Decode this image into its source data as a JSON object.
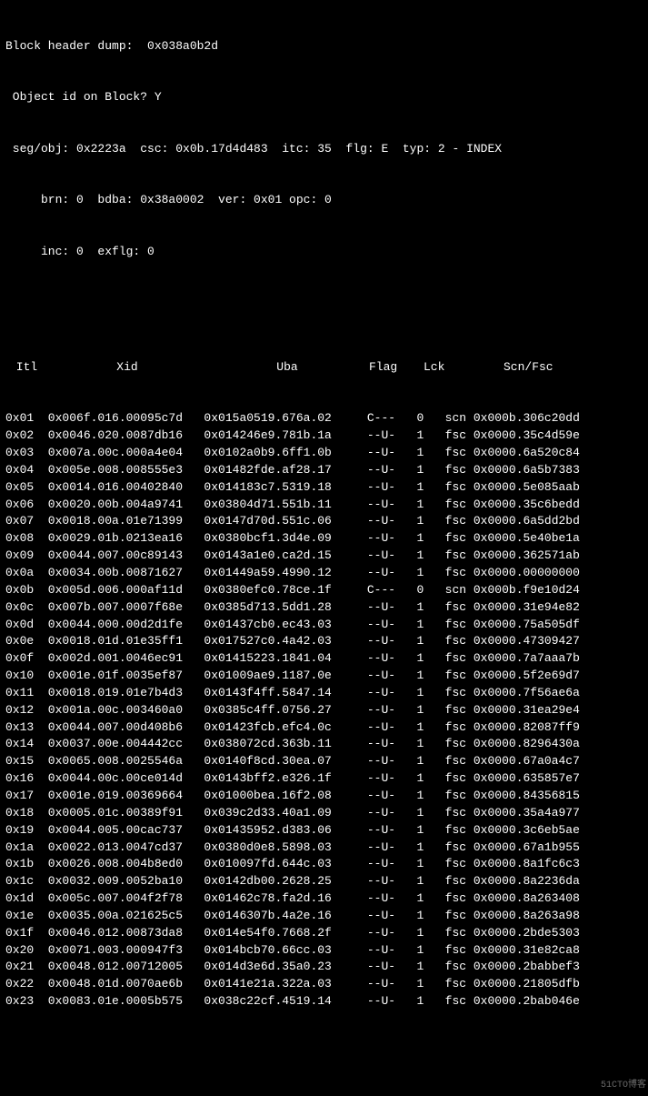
{
  "header": {
    "line1": "Block header dump:  0x038a0b2d",
    "line2": " Object id on Block? Y",
    "line3": " seg/obj: 0x2223a  csc: 0x0b.17d4d483  itc: 35  flg: E  typ: 2 - INDEX",
    "line4": "     brn: 0  bdba: 0x38a0002  ver: 0x01 opc: 0",
    "line5": "     inc: 0  exflg: 0"
  },
  "columns": {
    "itl": " Itl",
    "xid": "Xid",
    "uba": "Uba",
    "flag": "Flag",
    "lck": "Lck",
    "scn": "Scn/Fsc"
  },
  "rows": [
    {
      "itl": "0x01",
      "xid": "0x006f.016.00095c7d",
      "uba": "0x015a0519.676a.02",
      "flag": "C---",
      "lck": "0",
      "scn": "scn 0x000b.306c20dd"
    },
    {
      "itl": "0x02",
      "xid": "0x0046.020.0087db16",
      "uba": "0x014246e9.781b.1a",
      "flag": "--U-",
      "lck": "1",
      "scn": "fsc 0x0000.35c4d59e"
    },
    {
      "itl": "0x03",
      "xid": "0x007a.00c.000a4e04",
      "uba": "0x0102a0b9.6ff1.0b",
      "flag": "--U-",
      "lck": "1",
      "scn": "fsc 0x0000.6a520c84"
    },
    {
      "itl": "0x04",
      "xid": "0x005e.008.008555e3",
      "uba": "0x01482fde.af28.17",
      "flag": "--U-",
      "lck": "1",
      "scn": "fsc 0x0000.6a5b7383"
    },
    {
      "itl": "0x05",
      "xid": "0x0014.016.00402840",
      "uba": "0x014183c7.5319.18",
      "flag": "--U-",
      "lck": "1",
      "scn": "fsc 0x0000.5e085aab"
    },
    {
      "itl": "0x06",
      "xid": "0x0020.00b.004a9741",
      "uba": "0x03804d71.551b.11",
      "flag": "--U-",
      "lck": "1",
      "scn": "fsc 0x0000.35c6bedd"
    },
    {
      "itl": "0x07",
      "xid": "0x0018.00a.01e71399",
      "uba": "0x0147d70d.551c.06",
      "flag": "--U-",
      "lck": "1",
      "scn": "fsc 0x0000.6a5dd2bd"
    },
    {
      "itl": "0x08",
      "xid": "0x0029.01b.0213ea16",
      "uba": "0x0380bcf1.3d4e.09",
      "flag": "--U-",
      "lck": "1",
      "scn": "fsc 0x0000.5e40be1a"
    },
    {
      "itl": "0x09",
      "xid": "0x0044.007.00c89143",
      "uba": "0x0143a1e0.ca2d.15",
      "flag": "--U-",
      "lck": "1",
      "scn": "fsc 0x0000.362571ab"
    },
    {
      "itl": "0x0a",
      "xid": "0x0034.00b.00871627",
      "uba": "0x01449a59.4990.12",
      "flag": "--U-",
      "lck": "1",
      "scn": "fsc 0x0000.00000000"
    },
    {
      "itl": "0x0b",
      "xid": "0x005d.006.000af11d",
      "uba": "0x0380efc0.78ce.1f",
      "flag": "C---",
      "lck": "0",
      "scn": "scn 0x000b.f9e10d24"
    },
    {
      "itl": "0x0c",
      "xid": "0x007b.007.0007f68e",
      "uba": "0x0385d713.5dd1.28",
      "flag": "--U-",
      "lck": "1",
      "scn": "fsc 0x0000.31e94e82"
    },
    {
      "itl": "0x0d",
      "xid": "0x0044.000.00d2d1fe",
      "uba": "0x01437cb0.ec43.03",
      "flag": "--U-",
      "lck": "1",
      "scn": "fsc 0x0000.75a505df"
    },
    {
      "itl": "0x0e",
      "xid": "0x0018.01d.01e35ff1",
      "uba": "0x017527c0.4a42.03",
      "flag": "--U-",
      "lck": "1",
      "scn": "fsc 0x0000.47309427"
    },
    {
      "itl": "0x0f",
      "xid": "0x002d.001.0046ec91",
      "uba": "0x01415223.1841.04",
      "flag": "--U-",
      "lck": "1",
      "scn": "fsc 0x0000.7a7aaa7b"
    },
    {
      "itl": "0x10",
      "xid": "0x001e.01f.0035ef87",
      "uba": "0x01009ae9.1187.0e",
      "flag": "--U-",
      "lck": "1",
      "scn": "fsc 0x0000.5f2e69d7"
    },
    {
      "itl": "0x11",
      "xid": "0x0018.019.01e7b4d3",
      "uba": "0x0143f4ff.5847.14",
      "flag": "--U-",
      "lck": "1",
      "scn": "fsc 0x0000.7f56ae6a"
    },
    {
      "itl": "0x12",
      "xid": "0x001a.00c.003460a0",
      "uba": "0x0385c4ff.0756.27",
      "flag": "--U-",
      "lck": "1",
      "scn": "fsc 0x0000.31ea29e4"
    },
    {
      "itl": "0x13",
      "xid": "0x0044.007.00d408b6",
      "uba": "0x01423fcb.efc4.0c",
      "flag": "--U-",
      "lck": "1",
      "scn": "fsc 0x0000.82087ff9"
    },
    {
      "itl": "0x14",
      "xid": "0x0037.00e.004442cc",
      "uba": "0x038072cd.363b.11",
      "flag": "--U-",
      "lck": "1",
      "scn": "fsc 0x0000.8296430a"
    },
    {
      "itl": "0x15",
      "xid": "0x0065.008.0025546a",
      "uba": "0x0140f8cd.30ea.07",
      "flag": "--U-",
      "lck": "1",
      "scn": "fsc 0x0000.67a0a4c7"
    },
    {
      "itl": "0x16",
      "xid": "0x0044.00c.00ce014d",
      "uba": "0x0143bff2.e326.1f",
      "flag": "--U-",
      "lck": "1",
      "scn": "fsc 0x0000.635857e7"
    },
    {
      "itl": "0x17",
      "xid": "0x001e.019.00369664",
      "uba": "0x01000bea.16f2.08",
      "flag": "--U-",
      "lck": "1",
      "scn": "fsc 0x0000.84356815"
    },
    {
      "itl": "0x18",
      "xid": "0x0005.01c.00389f91",
      "uba": "0x039c2d33.40a1.09",
      "flag": "--U-",
      "lck": "1",
      "scn": "fsc 0x0000.35a4a977"
    },
    {
      "itl": "0x19",
      "xid": "0x0044.005.00cac737",
      "uba": "0x01435952.d383.06",
      "flag": "--U-",
      "lck": "1",
      "scn": "fsc 0x0000.3c6eb5ae"
    },
    {
      "itl": "0x1a",
      "xid": "0x0022.013.0047cd37",
      "uba": "0x0380d0e8.5898.03",
      "flag": "--U-",
      "lck": "1",
      "scn": "fsc 0x0000.67a1b955"
    },
    {
      "itl": "0x1b",
      "xid": "0x0026.008.004b8ed0",
      "uba": "0x010097fd.644c.03",
      "flag": "--U-",
      "lck": "1",
      "scn": "fsc 0x0000.8a1fc6c3"
    },
    {
      "itl": "0x1c",
      "xid": "0x0032.009.0052ba10",
      "uba": "0x0142db00.2628.25",
      "flag": "--U-",
      "lck": "1",
      "scn": "fsc 0x0000.8a2236da"
    },
    {
      "itl": "0x1d",
      "xid": "0x005c.007.004f2f78",
      "uba": "0x01462c78.fa2d.16",
      "flag": "--U-",
      "lck": "1",
      "scn": "fsc 0x0000.8a263408"
    },
    {
      "itl": "0x1e",
      "xid": "0x0035.00a.021625c5",
      "uba": "0x0146307b.4a2e.16",
      "flag": "--U-",
      "lck": "1",
      "scn": "fsc 0x0000.8a263a98"
    },
    {
      "itl": "0x1f",
      "xid": "0x0046.012.00873da8",
      "uba": "0x014e54f0.7668.2f",
      "flag": "--U-",
      "lck": "1",
      "scn": "fsc 0x0000.2bde5303"
    },
    {
      "itl": "0x20",
      "xid": "0x0071.003.000947f3",
      "uba": "0x014bcb70.66cc.03",
      "flag": "--U-",
      "lck": "1",
      "scn": "fsc 0x0000.31e82ca8"
    },
    {
      "itl": "0x21",
      "xid": "0x0048.012.00712005",
      "uba": "0x014d3e6d.35a0.23",
      "flag": "--U-",
      "lck": "1",
      "scn": "fsc 0x0000.2babbef3"
    },
    {
      "itl": "0x22",
      "xid": "0x0048.01d.0070ae6b",
      "uba": "0x0141e21a.322a.03",
      "flag": "--U-",
      "lck": "1",
      "scn": "fsc 0x0000.21805dfb"
    },
    {
      "itl": "0x23",
      "xid": "0x0083.01e.0005b575",
      "uba": "0x038c22cf.4519.14",
      "flag": "--U-",
      "lck": "1",
      "scn": "fsc 0x0000.2bab046e"
    }
  ],
  "watermark": "51CTO博客"
}
